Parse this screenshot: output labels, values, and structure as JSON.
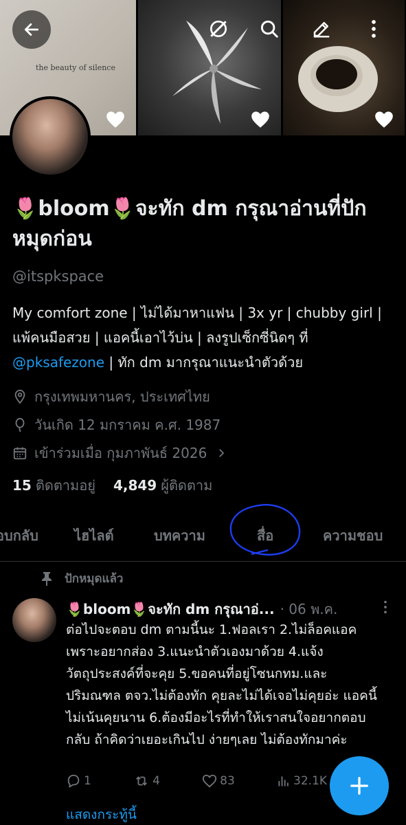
{
  "banner": {
    "quote": "the beauty of silence"
  },
  "profile": {
    "name": "🌷bloom🌷จะทัก dm กรุณาอ่านที่ปักหมุดก่อน",
    "handle": "@itspkspace",
    "bio_text": "My comfort zone | ไม่ได้มาหาแฟน | 3x yr | chubby girl | แพ้คนมือสวย | แอคนี้เอาไว้บ่น | ลงรูปเซ็กซี่นิดๆ ที่ ",
    "bio_mention": "@pksafezone",
    "bio_tail": " | ทัก dm มากรุณาแนะนำตัวด้วย",
    "location": "กรุงเทพมหานคร, ประเทศไทย",
    "birthday": "วันเกิด 12 มกราคม ค.ศ. 1987",
    "joined": "เข้าร่วมเมื่อ กุมภาพันธ์ 2026",
    "following_count": "15",
    "following_label": "ติดตามอยู่",
    "followers_count": "4,849",
    "followers_label": "ผู้ติดตาม"
  },
  "tabs": [
    "อบกลับ",
    "ไฮไลต์",
    "บทความ",
    "สื่อ",
    "ความชอบ"
  ],
  "post": {
    "pinned_label": "ปักหมุดแล้ว",
    "author": "🌷bloom🌷จะทัก dm กรุณาอ่...",
    "date": "· 06 พ.ค.",
    "body": "ต่อไปจะตอบ dm ตามนี้นะ 1.ฟอลเรา 2.ไม่ล็อคแอค เพราะอยากส่อง 3.แนะนำตัวเองมาด้วย 4.แจ้งวัตถุประสงค์ที่จะคุย 5.ขอคนที่อยู่โซนกทม.และปริมณฑล ตจว.ไม่ต้องทัก คุยละไม่ได้เจอไม่คุยอ่ะ แอคนี้ไม่เน้นคุยนาน 6.ต้องมีอะไรที่ทำให้เราสนใจอยากตอบกลับ ถ้าคิดว่าเยอะเกินไป ง่ายๆเลย ไม่ต้องทักมาค่ะ",
    "replies": "1",
    "reposts": "4",
    "likes": "83",
    "views": "32.1K",
    "show_thread": "แสดงกระทู้นี้"
  },
  "colors": {
    "accent": "#1d9bf0",
    "muted": "#71767b",
    "text": "#e7e9ea",
    "background": "#000000"
  }
}
